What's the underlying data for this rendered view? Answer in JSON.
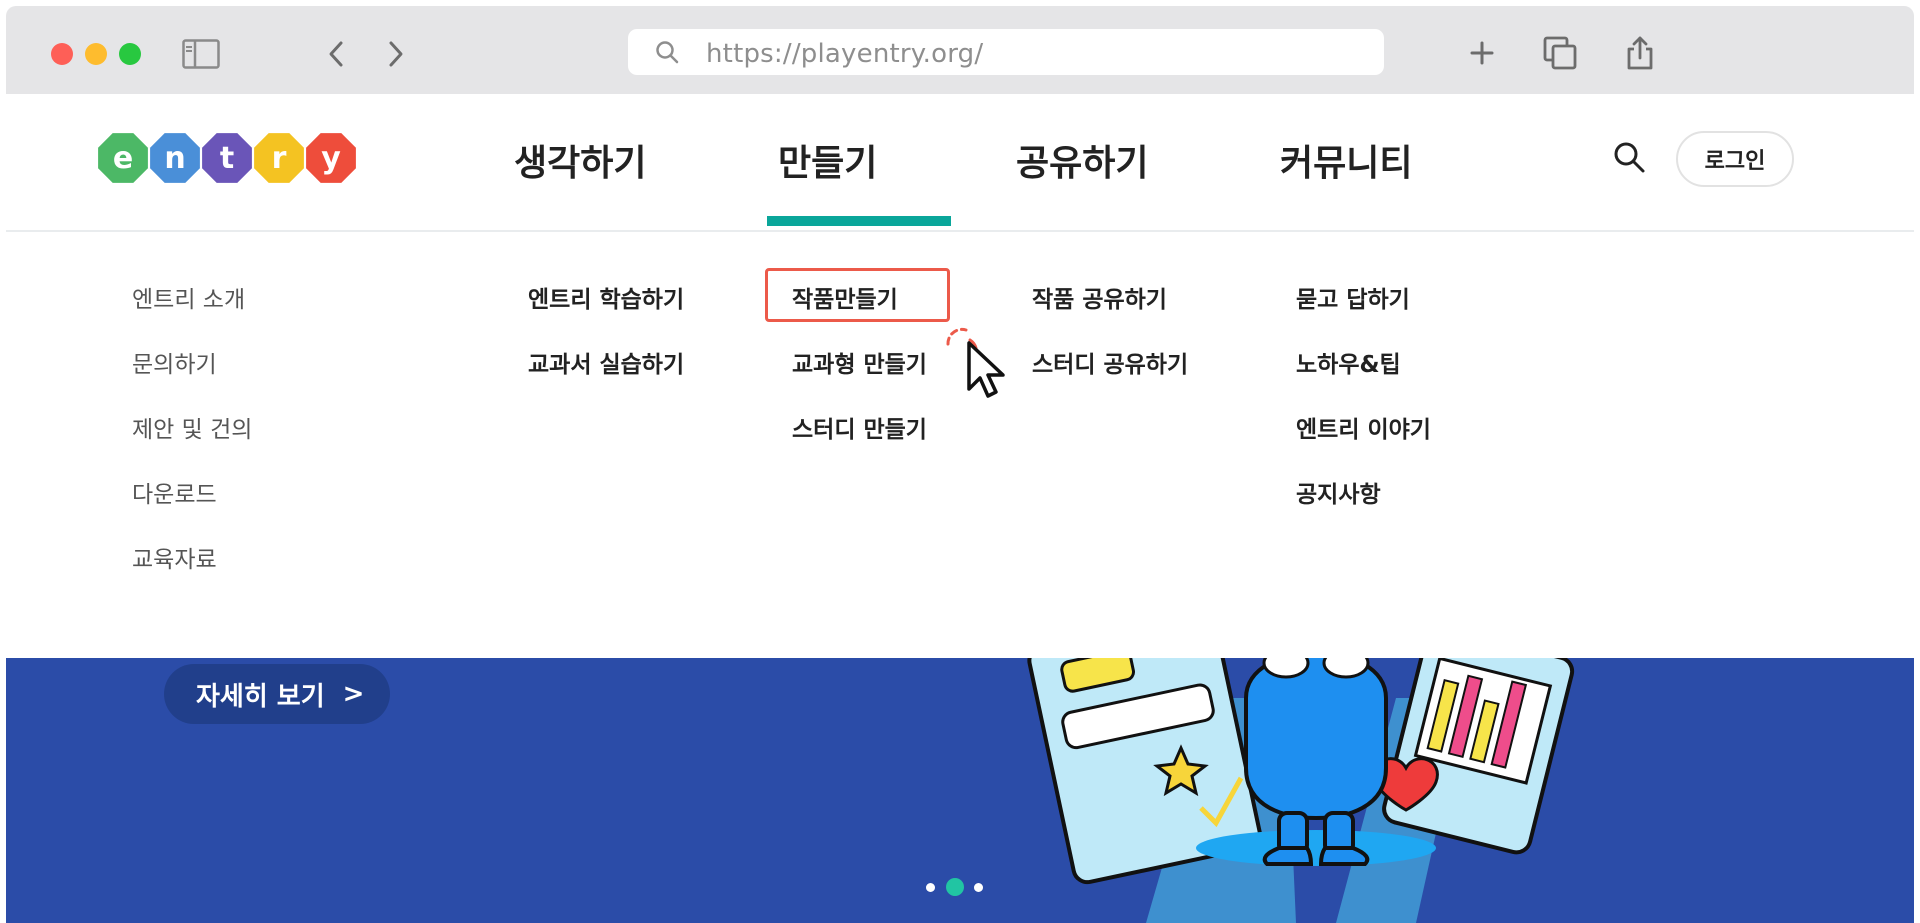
{
  "browser": {
    "url": "https://playentry.org/",
    "icons": [
      "sidebar-icon",
      "back-icon",
      "forward-icon",
      "search-icon",
      "new-tab-icon",
      "tabs-icon",
      "share-icon"
    ]
  },
  "header": {
    "logo_letters": [
      "e",
      "n",
      "t",
      "r",
      "y"
    ],
    "logo_colors": [
      "#4cb866",
      "#4a8fd8",
      "#6a55b8",
      "#f4c322",
      "#ee4d3b"
    ],
    "nav": [
      {
        "label": "생각하기"
      },
      {
        "label": "만들기",
        "active": true
      },
      {
        "label": "공유하기"
      },
      {
        "label": "커뮤니티"
      }
    ],
    "login_label": "로그인",
    "accent_color": "#0aa69a"
  },
  "dropdown": {
    "col1": [
      "엔트리 소개",
      "문의하기",
      "제안 및 건의",
      "다운로드",
      "교육자료"
    ],
    "col2": [
      "엔트리 학습하기",
      "교과서 실습하기"
    ],
    "col3": [
      "작품만들기",
      "교과형 만들기",
      "스터디 만들기"
    ],
    "col4": [
      "작품 공유하기",
      "스터디 공유하기"
    ],
    "col5": [
      "묻고 답하기",
      "노하우&팁",
      "엔트리 이야기",
      "공지사항"
    ],
    "highlighted": "작품만들기"
  },
  "banner": {
    "detail_label": "자세히 보기",
    "detail_chevron": ">",
    "background": "#2b4ca8",
    "pager": {
      "count": 3,
      "active": 2
    }
  }
}
